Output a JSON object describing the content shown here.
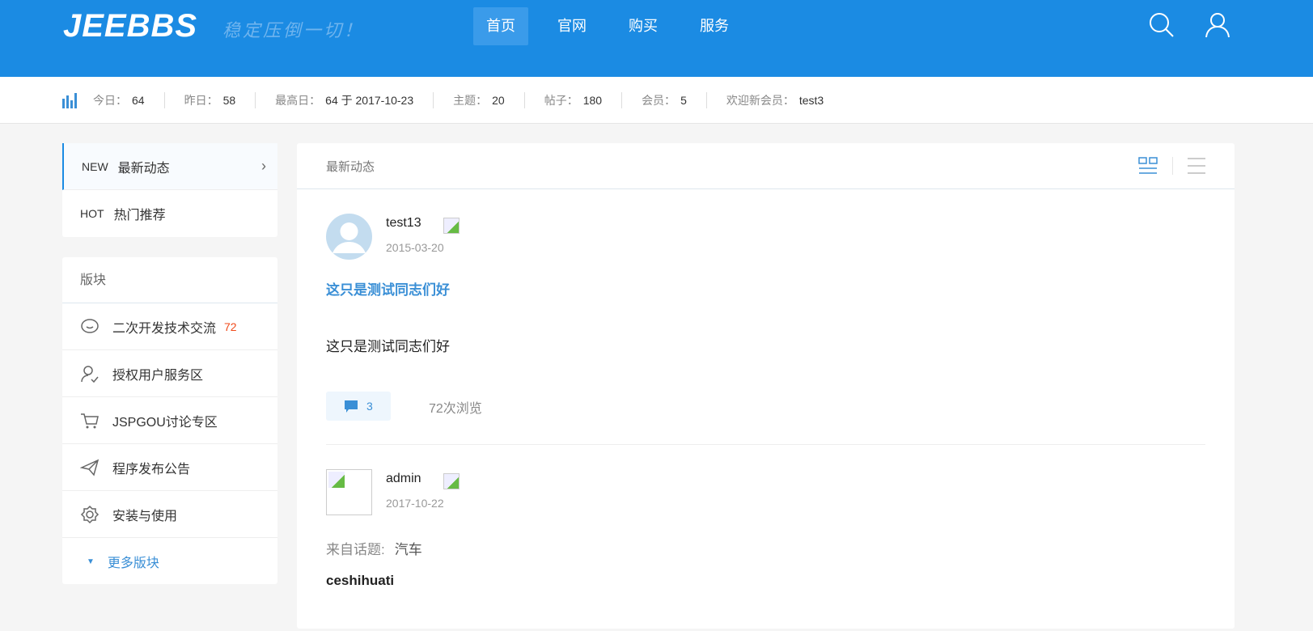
{
  "header": {
    "logo": "JEEBBS",
    "slogan": "稳定压倒一切！",
    "nav": [
      "首页",
      "官网",
      "购买",
      "服务"
    ]
  },
  "stats": [
    {
      "label": "今日：",
      "value": "64"
    },
    {
      "label": "昨日：",
      "value": "58"
    },
    {
      "label": "最高日：",
      "value": "64 于 2017-10-23"
    },
    {
      "label": "主题：",
      "value": "20"
    },
    {
      "label": "帖子：",
      "value": "180"
    },
    {
      "label": "会员：",
      "value": "5"
    },
    {
      "label": "欢迎新会员：",
      "value": "test3"
    }
  ],
  "tabs": [
    {
      "tag": "NEW",
      "label": "最新动态"
    },
    {
      "tag": "HOT",
      "label": "热门推荐"
    }
  ],
  "boards": {
    "title": "版块",
    "items": [
      {
        "label": "二次开发技术交流",
        "count": "72"
      },
      {
        "label": "授权用户服务区"
      },
      {
        "label": "JSPGOU讨论专区"
      },
      {
        "label": "程序发布公告"
      },
      {
        "label": "安装与使用"
      }
    ],
    "more": "更多版块"
  },
  "main": {
    "title": "最新动态",
    "posts": [
      {
        "user": "test13",
        "date": "2015-03-20",
        "title": "这只是测试同志们好",
        "body": "这只是测试同志们好",
        "comments": "3",
        "views": "72次浏览"
      },
      {
        "user": "admin",
        "date": "2017-10-22",
        "topic_label": "来自话题:",
        "topic": "汽车",
        "title": "ceshihuati"
      }
    ]
  }
}
